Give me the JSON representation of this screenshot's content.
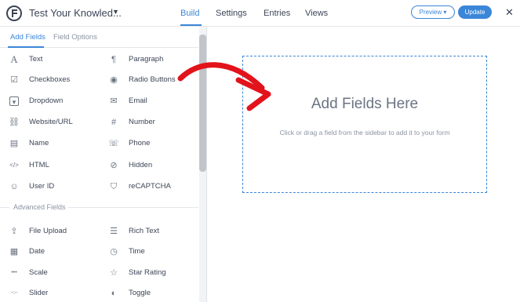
{
  "header": {
    "form_title": "Test Your Knowled...",
    "tabs": [
      {
        "label": "Build"
      },
      {
        "label": "Settings"
      },
      {
        "label": "Entries"
      },
      {
        "label": "Views"
      }
    ],
    "preview_label": "Preview ▾",
    "update_label": "Update",
    "close_glyph": "✕"
  },
  "sidebar": {
    "tabs": [
      {
        "label": "Add Fields"
      },
      {
        "label": "Field Options"
      }
    ],
    "basic_fields": [
      {
        "label": "Text",
        "icon": "text-icon",
        "glyph": "A"
      },
      {
        "label": "Paragraph",
        "icon": "paragraph-icon",
        "glyph": "¶"
      },
      {
        "label": "Checkboxes",
        "icon": "checkbox-icon",
        "glyph": "☑"
      },
      {
        "label": "Radio Buttons",
        "icon": "radio-icon",
        "glyph": "◉"
      },
      {
        "label": "Dropdown",
        "icon": "dropdown-icon",
        "glyph": "▾"
      },
      {
        "label": "Email",
        "icon": "email-icon",
        "glyph": "✉"
      },
      {
        "label": "Website/URL",
        "icon": "link-icon",
        "glyph": "⛓"
      },
      {
        "label": "Number",
        "icon": "number-icon",
        "glyph": "#"
      },
      {
        "label": "Name",
        "icon": "name-card-icon",
        "glyph": "▤"
      },
      {
        "label": "Phone",
        "icon": "phone-icon",
        "glyph": "☏"
      },
      {
        "label": "HTML",
        "icon": "code-icon",
        "glyph": "</>"
      },
      {
        "label": "Hidden",
        "icon": "hidden-eye-icon",
        "glyph": "⊘"
      },
      {
        "label": "User ID",
        "icon": "user-icon",
        "glyph": "☺"
      },
      {
        "label": "reCAPTCHA",
        "icon": "shield-icon",
        "glyph": "⛉"
      }
    ],
    "advanced_section_label": "Advanced Fields",
    "advanced_fields": [
      {
        "label": "File Upload",
        "icon": "upload-icon",
        "glyph": "⇪"
      },
      {
        "label": "Rich Text",
        "icon": "rich-text-icon",
        "glyph": "☰"
      },
      {
        "label": "Date",
        "icon": "calendar-icon",
        "glyph": "▦"
      },
      {
        "label": "Time",
        "icon": "clock-icon",
        "glyph": "◷"
      },
      {
        "label": "Scale",
        "icon": "scale-icon",
        "glyph": "•••"
      },
      {
        "label": "Star Rating",
        "icon": "star-icon",
        "glyph": "☆"
      },
      {
        "label": "Slider",
        "icon": "slider-icon",
        "glyph": "-○-"
      },
      {
        "label": "Toggle",
        "icon": "toggle-icon",
        "glyph": "◐"
      }
    ]
  },
  "canvas": {
    "title": "Add Fields Here",
    "subtitle": "Click or drag a field from the sidebar to add it to your form"
  },
  "colors": {
    "accent": "#3a86d8",
    "annotation_arrow": "#e3131b"
  }
}
